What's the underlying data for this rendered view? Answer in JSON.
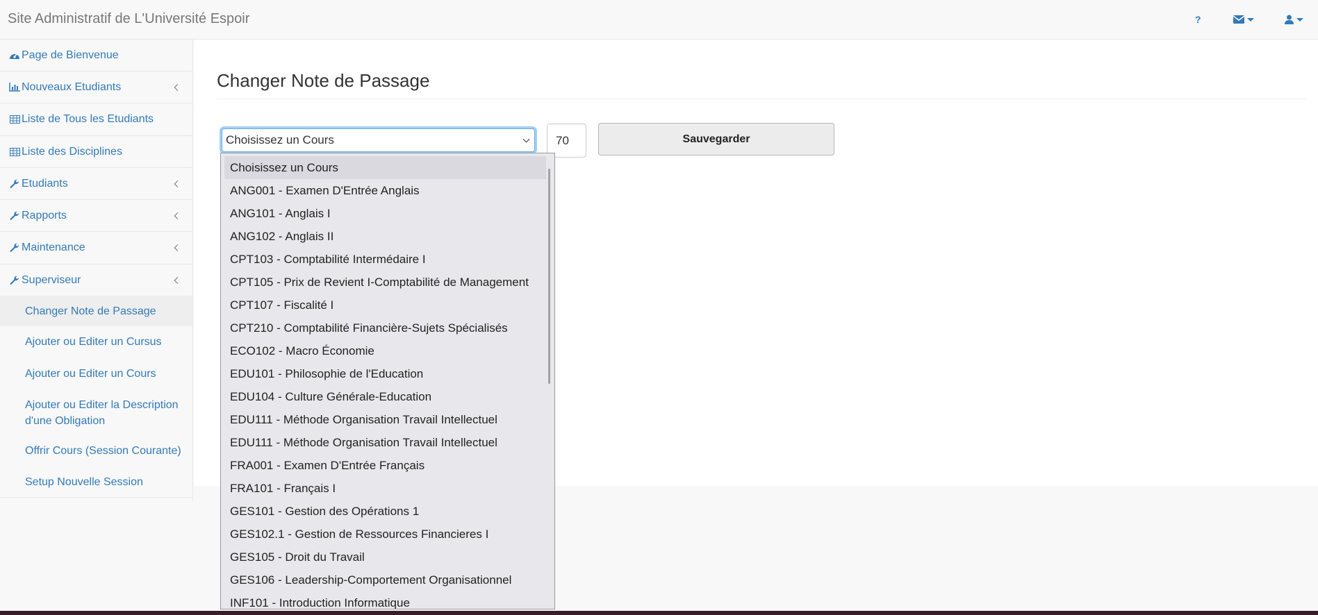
{
  "navbar": {
    "brand": "Site Administratif de L'Université Espoir",
    "help_label": "?"
  },
  "sidebar": {
    "items": [
      {
        "label": "Page de Bienvenue",
        "icon": "dashboard-icon"
      },
      {
        "label": "Nouveaux Etudiants",
        "icon": "bar-chart-icon"
      },
      {
        "label": "Liste de Tous les Etudiants",
        "icon": "table-icon"
      },
      {
        "label": "Liste des Disciplines",
        "icon": "table-icon"
      },
      {
        "label": "Etudiants",
        "icon": "wrench-icon"
      },
      {
        "label": "Rapports",
        "icon": "wrench-icon"
      },
      {
        "label": "Maintenance",
        "icon": "wrench-icon"
      },
      {
        "label": "Superviseur",
        "icon": "wrench-icon"
      }
    ],
    "sub_items": [
      {
        "label": "Changer Note de Passage"
      },
      {
        "label": "Ajouter ou Editer un Cursus"
      },
      {
        "label": "Ajouter ou Editer un Cours"
      },
      {
        "label": "Ajouter ou Editer la Description d'une Obligation"
      },
      {
        "label": "Offrir Cours (Session Courante)"
      },
      {
        "label": "Setup Nouvelle Session"
      }
    ]
  },
  "main": {
    "title": "Changer Note de Passage",
    "course_select_value": "Choisissez un Cours",
    "passing_grade": "70",
    "save_label": "Sauvegarder"
  },
  "dropdown": {
    "options": [
      "Choisissez un Cours",
      "ANG001 - Examen D'Entrée Anglais",
      "ANG101 - Anglais I",
      "ANG102 - Anglais II",
      "CPT103 - Comptabilité Intermédaire I",
      "CPT105 - Prix de Revient I-Comptabilité de Management",
      "CPT107 - Fiscalité I",
      "CPT210 - Comptabilité Financière-Sujets Spécialisés",
      "ECO102 - Macro Économie",
      "EDU101 - Philosophie de l'Education",
      "EDU104 - Culture Générale-Education",
      "EDU111 - Méthode Organisation Travail Intellectuel",
      "EDU111 - Méthode Organisation Travail Intellectuel",
      "FRA001 - Examen D'Entrée Français",
      "FRA101 - Français I",
      "GES101 - Gestion des Opérations 1",
      "GES102.1 - Gestion de Ressources Financieres I",
      "GES105 - Droit du Travail",
      "GES106 - Leadership-Comportement Organisationnel",
      "INF101 - Introduction Informatique"
    ]
  }
}
